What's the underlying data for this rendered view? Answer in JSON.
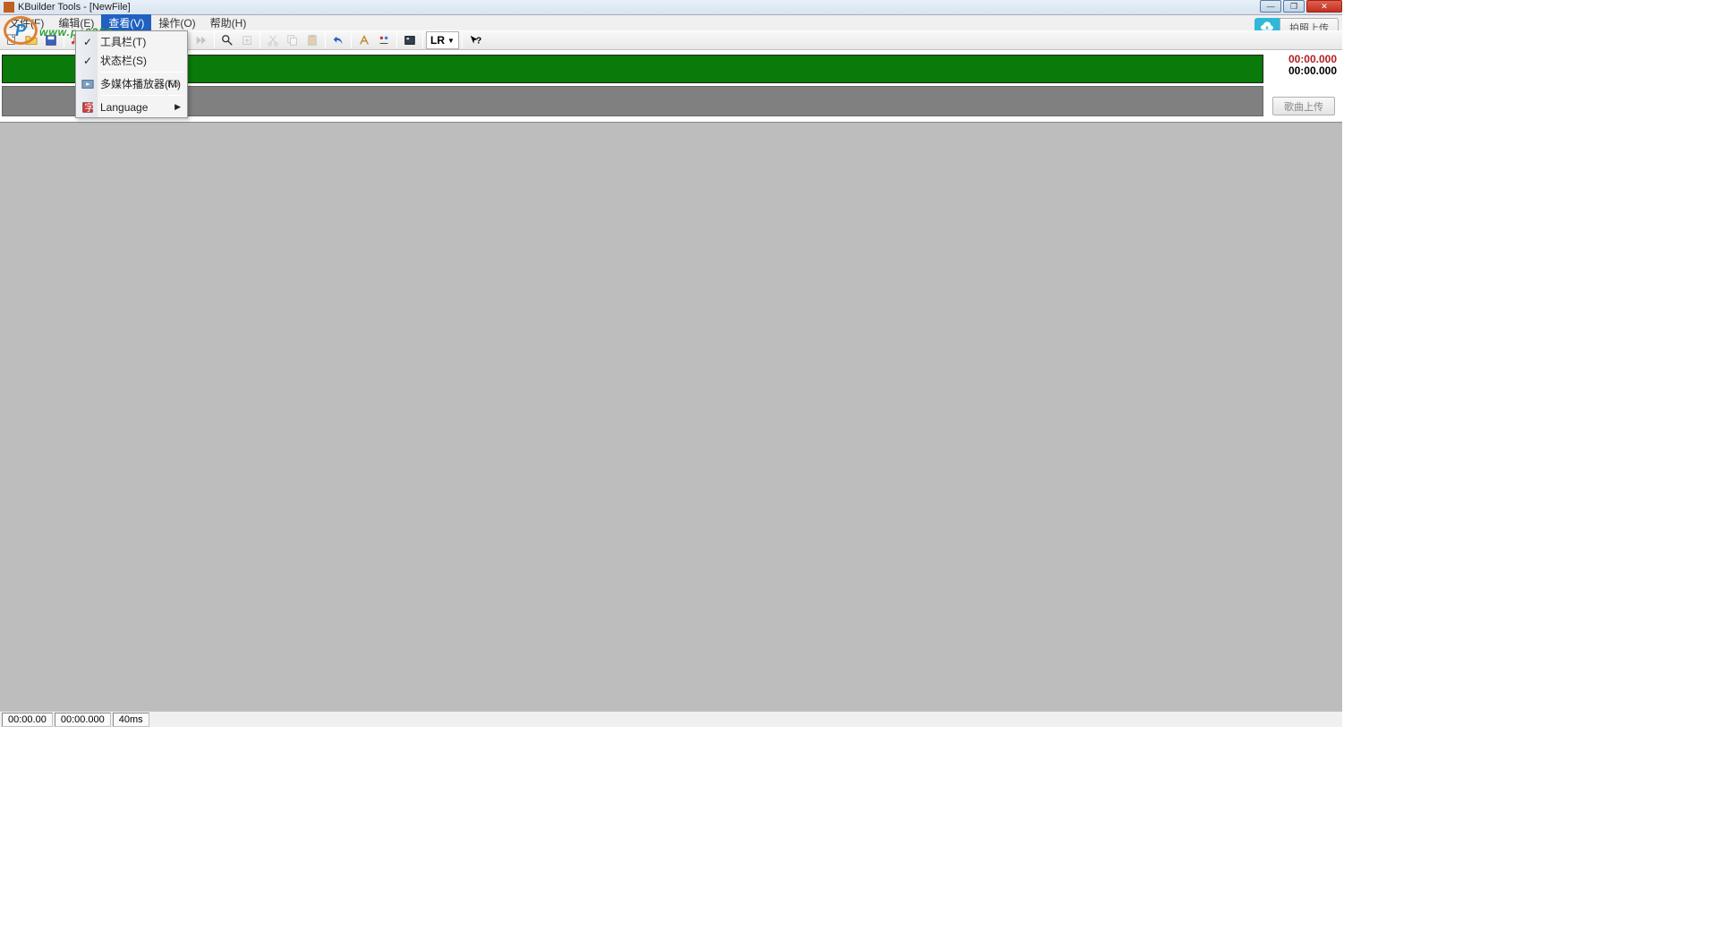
{
  "window": {
    "title": "KBuilder Tools - [NewFile]"
  },
  "menubar": {
    "items": [
      {
        "label": "文件(F)"
      },
      {
        "label": "编辑(E)"
      },
      {
        "label": "查看(V)",
        "active": true
      },
      {
        "label": "操作(O)"
      },
      {
        "label": "帮助(H)"
      }
    ]
  },
  "upload": {
    "label": "拍照上传"
  },
  "watermark": {
    "domain": "www.pc0359.cn"
  },
  "dropdown": {
    "items": [
      {
        "label": "工具栏(T)",
        "icon": "check"
      },
      {
        "label": "状态栏(S)",
        "icon": "check"
      },
      {
        "sep": true
      },
      {
        "label": "多媒体播放器(M)",
        "shortcut": "F5",
        "icon": "media"
      },
      {
        "sep": true
      },
      {
        "label": "Language",
        "icon": "lang",
        "submenu": true
      }
    ]
  },
  "toolbar": {
    "lr_label": "LR"
  },
  "time": {
    "t1": "00:00.000",
    "t2": "00:00.000"
  },
  "song_upload": {
    "label": "歌曲上传"
  },
  "statusbar": {
    "cells": [
      "00:00.00",
      "00:00.000",
      "40ms"
    ]
  }
}
